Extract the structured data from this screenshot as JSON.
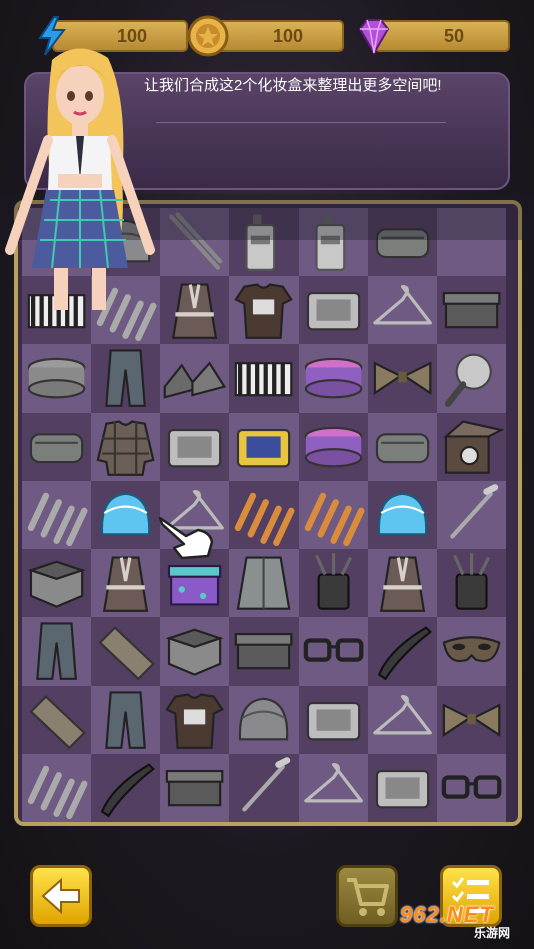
{
  "stats": {
    "energy": {
      "value": "100",
      "icon": "lightning-icon",
      "color": "#1f8fd8"
    },
    "coins": {
      "value": "100",
      "icon": "coin-icon",
      "color": "#e0a838"
    },
    "gems": {
      "value": "50",
      "icon": "gem-icon",
      "color": "#b34fd8"
    }
  },
  "dialog": {
    "message": "让我们合成这2个化妆盒来整理出更多空间吧!"
  },
  "board": {
    "columns": 7,
    "rows": 9,
    "items": [
      "",
      "makeup-pouch",
      "tweezers",
      "cleanser-bottle",
      "cleanser-bottle",
      "toiletry-bag",
      "",
      "striped-box",
      "clothespins",
      "bathrobe",
      "graphic-tshirt",
      "makeup-case",
      "hanger",
      "gift-box",
      "round-box",
      "jeans",
      "sneakers",
      "striped-box",
      "round-box-pink",
      "bow-tie",
      "makeup-brush",
      "toiletry-bag",
      "plaid-shirt",
      "makeup-case",
      "makeup-case-yellow",
      "round-box-pink",
      "toiletry-bag",
      "watch-box",
      "clothespins",
      "makeup-pouch-blue",
      "hanger",
      "clothespins-orange",
      "clothespins-orange",
      "makeup-pouch-blue",
      "makeup-brush-stick",
      "open-box",
      "bathrobe",
      "gift-box-purple",
      "jacket",
      "brush-cup",
      "bathrobe",
      "brush-cup",
      "jeans",
      "necktie",
      "open-box",
      "gift-box",
      "glasses",
      "hair-clip",
      "mask",
      "necktie",
      "jeans",
      "graphic-tshirt",
      "makeup-pouch",
      "makeup-case",
      "hanger",
      "bow-tie",
      "clothespins",
      "hair-clip",
      "gift-box",
      "makeup-brush-stick",
      "hanger",
      "makeup-case",
      "glasses"
    ]
  },
  "buttons": {
    "back": {
      "icon": "arrow-left-icon"
    },
    "cart": {
      "icon": "cart-icon"
    },
    "tasks": {
      "icon": "checklist-icon"
    }
  },
  "watermark": {
    "main": "962.NET",
    "sub": "乐游网"
  },
  "character": {
    "icon": "girl-character"
  }
}
